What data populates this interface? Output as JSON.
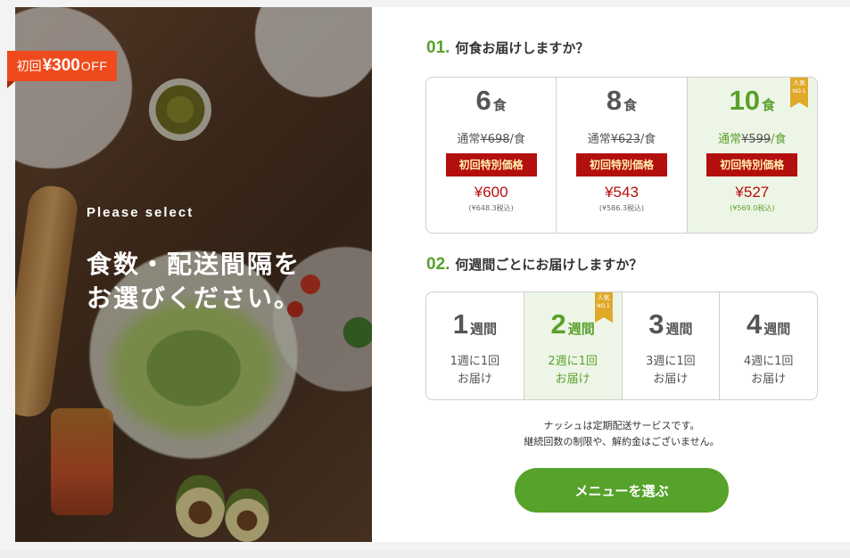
{
  "promo_badge": {
    "prefix": "初回",
    "amount": "¥300",
    "suffix": "OFF"
  },
  "hero": {
    "tagline": "Please select",
    "headline_line1": "食数・配送間隔を",
    "headline_line2": "お選びください。"
  },
  "meal_question": {
    "num": "01.",
    "text": "何食お届けしますか？"
  },
  "meal_options": [
    {
      "count": "6",
      "unit": "食",
      "regular_label": "通常",
      "regular_price": "¥698",
      "regular_suffix": "/食",
      "special_label": "初回特別価格",
      "price": "¥600",
      "tax_in": "(¥648.3税込)",
      "selected": false
    },
    {
      "count": "8",
      "unit": "食",
      "regular_label": "通常",
      "regular_price": "¥623",
      "regular_suffix": "/食",
      "special_label": "初回特別価格",
      "price": "¥543",
      "tax_in": "(¥586.3税込)",
      "selected": false
    },
    {
      "count": "10",
      "unit": "食",
      "regular_label": "通常",
      "regular_price": "¥599",
      "regular_suffix": "/食",
      "special_label": "初回特別価格",
      "price": "¥527",
      "tax_in": "(¥569.0税込)",
      "selected": true,
      "popular_top": "人気",
      "popular_bottom": "NO.1"
    }
  ],
  "interval_question": {
    "num": "02.",
    "text": "何週間ごとにお届けしますか？"
  },
  "interval_options": [
    {
      "count": "1",
      "unit": "週間",
      "line1": "1週に1回",
      "line2": "お届け",
      "selected": false
    },
    {
      "count": "2",
      "unit": "週間",
      "line1": "2週に1回",
      "line2": "お届け",
      "selected": true,
      "popular_top": "人気",
      "popular_bottom": "NO.1"
    },
    {
      "count": "3",
      "unit": "週間",
      "line1": "3週に1回",
      "line2": "お届け",
      "selected": false
    },
    {
      "count": "4",
      "unit": "週間",
      "line1": "4週に1回",
      "line2": "お届け",
      "selected": false
    }
  ],
  "notes": {
    "line1": "ナッシュは定期配送サービスです。",
    "line2": "継続回数の制限や、解約金はございません。"
  },
  "cta_label": "メニューを選ぶ",
  "colors": {
    "accent_green": "#56a22a",
    "price_red": "#b40f0f",
    "badge_orange": "#ef4a1c",
    "selected_bg": "#edf6e6"
  }
}
